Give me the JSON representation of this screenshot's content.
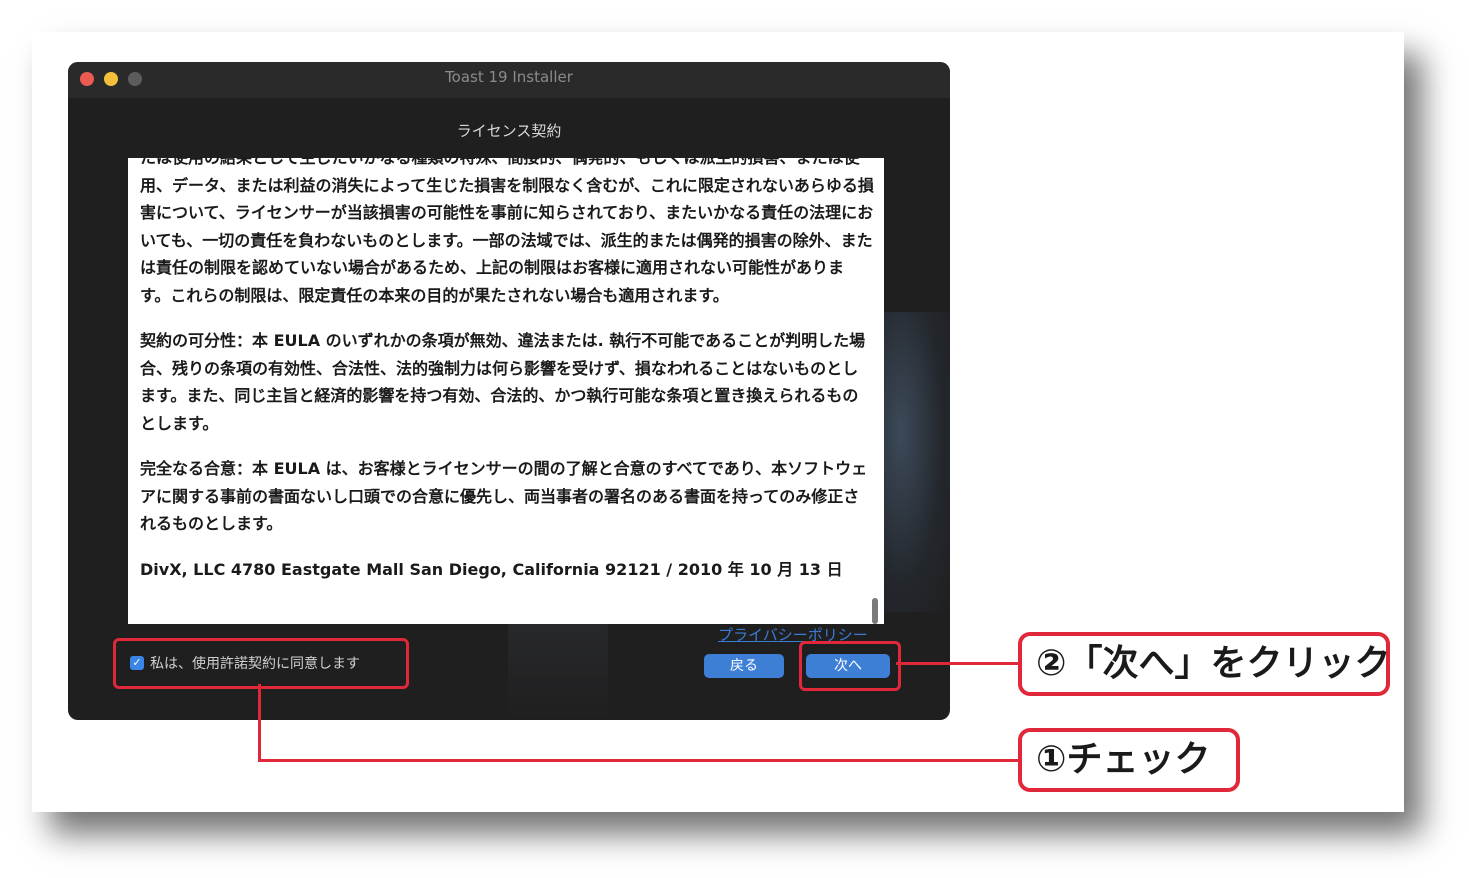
{
  "window": {
    "title": "Toast 19 Installer",
    "section_title": "ライセンス契約"
  },
  "license": {
    "paragraphs": [
      "たは使用の結果として生じたいかなる種類の特殊、間接的、偶発的、もしくは派生的損害、または使用、データ、または利益の消失によって生じた損害を制限なく含むが、これに限定されないあらゆる損害について、ライセンサーが当該損害の可能性を事前に知らされており、またいかなる責任の法理においても、一切の責任を負わないものとします。一部の法域では、派生的または偶発的損害の除外、または責任の制限を認めていない場合があるため、上記の制限はお客様に適用されない可能性があります。これらの制限は、限定責任の本来の目的が果たされない場合も適用されます。",
      "契約の可分性：本 EULA のいずれかの条項が無効、違法または. 執行不可能であることが判明した場合、残りの条項の有効性、合法性、法的強制力は何ら影響を受けず、損なわれることはないものとします。また、同じ主旨と経済的影響を持つ有効、合法的、かつ執行可能な条項と置き換えられるものとします。",
      "完全なる合意：本 EULA は、お客様とライセンサーの間の了解と合意のすべてであり、本ソフトウェアに関する事前の書面ないし口頭での合意に優先し、両当事者の署名のある書面を持ってのみ修正されるものとします。"
    ],
    "address": "DivX, LLC 4780 Eastgate Mall San Diego, California 92121 / 2010 年 10 月 13 日"
  },
  "links": {
    "privacy": "プライバシーポリシー"
  },
  "agree": {
    "label": "私は、使用許諾契約に同意します",
    "checked": true
  },
  "buttons": {
    "back": "戻る",
    "next": "次へ"
  },
  "callouts": {
    "step2": "②「次へ」をクリック",
    "step1": "①チェック"
  },
  "colors": {
    "highlight": "#e0283a",
    "button": "#3e7fd6",
    "window_bg": "#1f1f20"
  }
}
